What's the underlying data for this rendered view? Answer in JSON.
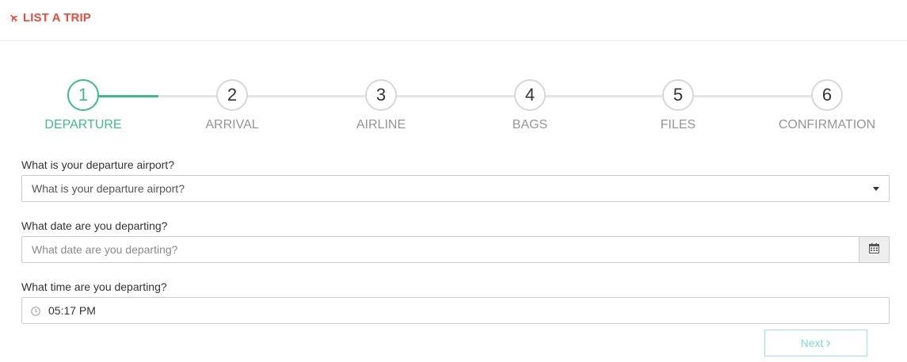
{
  "header": {
    "title": "LIST A TRIP",
    "icon": "airplane-icon",
    "accent_color": "#e74c3c"
  },
  "stepper": {
    "active_color": "#3dbd85",
    "steps": [
      {
        "number": "1",
        "label": "DEPARTURE",
        "active": true
      },
      {
        "number": "2",
        "label": "ARRIVAL",
        "active": false
      },
      {
        "number": "3",
        "label": "AIRLINE",
        "active": false
      },
      {
        "number": "4",
        "label": "BAGS",
        "active": false
      },
      {
        "number": "5",
        "label": "FILES",
        "active": false
      },
      {
        "number": "6",
        "label": "CONFIRMATION",
        "active": false
      }
    ]
  },
  "form": {
    "airport": {
      "label": "What is your departure airport?",
      "selected": "What is your departure airport?",
      "icon": "chevron-down-icon"
    },
    "date": {
      "label": "What date are you departing?",
      "placeholder": "What date are you departing?",
      "value": "",
      "icon": "calendar-icon"
    },
    "time": {
      "label": "What time are you departing?",
      "value": "05:17 PM",
      "icon": "clock-icon"
    }
  },
  "actions": {
    "next_label": "Next",
    "next_icon": "chevron-right-icon",
    "next_color": "#7fd8d4"
  }
}
